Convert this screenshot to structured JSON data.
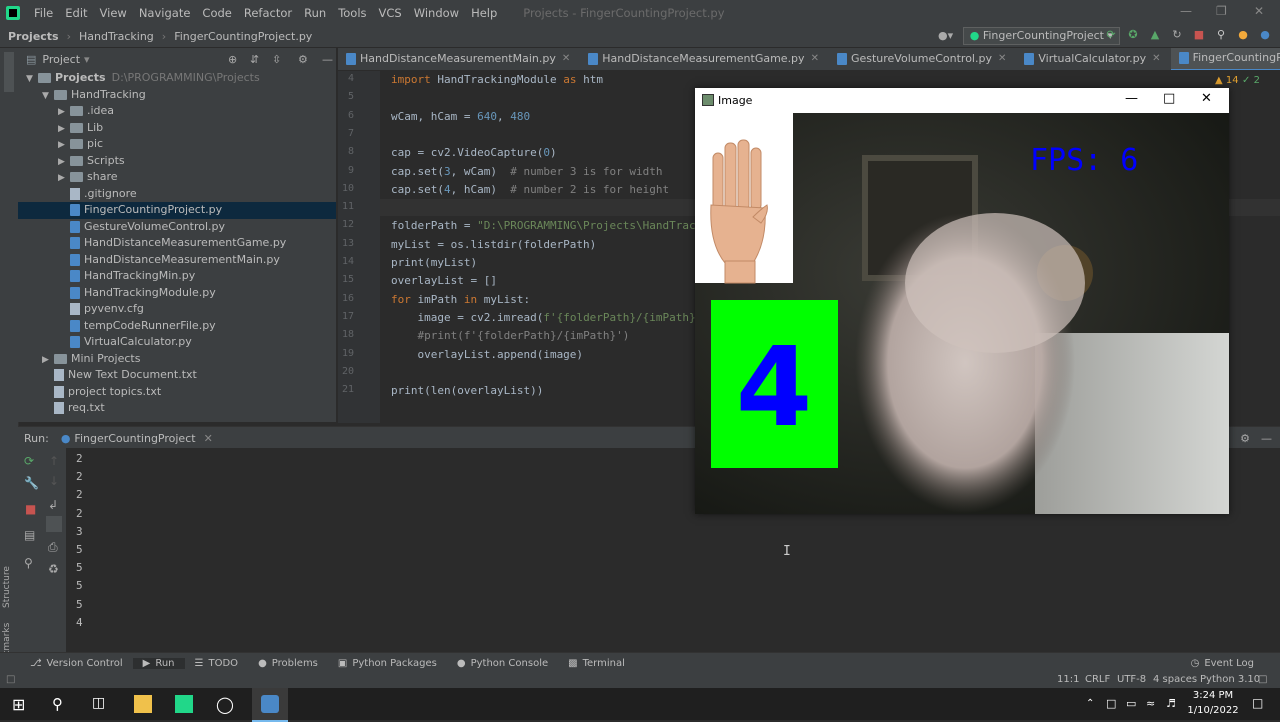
{
  "menubar": {
    "items": [
      "File",
      "Edit",
      "View",
      "Navigate",
      "Code",
      "Refactor",
      "Run",
      "Tools",
      "VCS",
      "Window",
      "Help"
    ],
    "window_title": "Projects - FingerCountingProject.py"
  },
  "navbar": {
    "crumbs": [
      "Projects",
      "HandTracking",
      "FingerCountingProject.py"
    ],
    "run_config": "FingerCountingProject"
  },
  "project_panel": {
    "title": "Project",
    "root_label": "Projects",
    "root_path": "D:\\PROGRAMMING\\Projects",
    "tree": [
      {
        "label": "HandTracking",
        "kind": "folder",
        "depth": 1,
        "expanded": true
      },
      {
        "label": ".idea",
        "kind": "folder",
        "depth": 2
      },
      {
        "label": "Lib",
        "kind": "folder",
        "depth": 2
      },
      {
        "label": "pic",
        "kind": "folder",
        "depth": 2
      },
      {
        "label": "Scripts",
        "kind": "folder",
        "depth": 2
      },
      {
        "label": "share",
        "kind": "folder",
        "depth": 2
      },
      {
        "label": ".gitignore",
        "kind": "txt",
        "depth": 2
      },
      {
        "label": "FingerCountingProject.py",
        "kind": "py",
        "depth": 2,
        "selected": true
      },
      {
        "label": "GestureVolumeControl.py",
        "kind": "py",
        "depth": 2
      },
      {
        "label": "HandDistanceMeasurementGame.py",
        "kind": "py",
        "depth": 2
      },
      {
        "label": "HandDistanceMeasurementMain.py",
        "kind": "py",
        "depth": 2
      },
      {
        "label": "HandTrackingMin.py",
        "kind": "py",
        "depth": 2
      },
      {
        "label": "HandTrackingModule.py",
        "kind": "py",
        "depth": 2
      },
      {
        "label": "pyvenv.cfg",
        "kind": "txt",
        "depth": 2
      },
      {
        "label": "tempCodeRunnerFile.py",
        "kind": "py",
        "depth": 2
      },
      {
        "label": "VirtualCalculator.py",
        "kind": "py",
        "depth": 2
      },
      {
        "label": "Mini Projects",
        "kind": "folder",
        "depth": 1
      },
      {
        "label": "New Text Document.txt",
        "kind": "txt",
        "depth": 1
      },
      {
        "label": "project topics.txt",
        "kind": "txt",
        "depth": 1
      },
      {
        "label": "req.txt",
        "kind": "txt",
        "depth": 1
      }
    ]
  },
  "tabs": [
    {
      "label": "HandDistanceMeasurementMain.py",
      "active": false
    },
    {
      "label": "HandDistanceMeasurementGame.py",
      "active": false
    },
    {
      "label": "GestureVolumeControl.py",
      "active": false
    },
    {
      "label": "VirtualCalculator.py",
      "active": false
    },
    {
      "label": "FingerCountingProject.py",
      "active": true
    }
  ],
  "inspections": {
    "warnings": "14",
    "weak": "2"
  },
  "editor": {
    "lines": [
      {
        "n": "4",
        "html": "<span class=\"kw\">import</span> HandTrackingModule <span class=\"kw\">as</span> htm"
      },
      {
        "n": "5",
        "html": ""
      },
      {
        "n": "6",
        "html": "wCam, hCam = <span class=\"num\">640</span>, <span class=\"num\">480</span>"
      },
      {
        "n": "7",
        "html": ""
      },
      {
        "n": "8",
        "html": "cap = cv2.VideoCapture(<span class=\"num\">0</span>)"
      },
      {
        "n": "9",
        "html": "cap.set(<span class=\"num\">3</span>, wCam)  <span class=\"cmt\"># number 3 is for width</span>"
      },
      {
        "n": "10",
        "html": "cap.set(<span class=\"num\">4</span>, hCam)  <span class=\"cmt\"># number 2 is for height</span>"
      },
      {
        "n": "11",
        "html": ""
      },
      {
        "n": "12",
        "html": "folderPath = <span class=\"str\">\"D:\\PROGRAMMING\\Projects\\HandTrac</span>"
      },
      {
        "n": "13",
        "html": "myList = os.listdir(folderPath)"
      },
      {
        "n": "14",
        "html": "print(myList)"
      },
      {
        "n": "15",
        "html": "overlayList = []"
      },
      {
        "n": "16",
        "html": "<span class=\"kw\">for</span> imPath <span class=\"kw\">in</span> myList:"
      },
      {
        "n": "17",
        "html": "    image = cv2.imread(<span class=\"str\">f'{folderPath}/{imPath}</span>"
      },
      {
        "n": "18",
        "html": "    <span class=\"cmt\">#print(f'{folderPath}/{imPath}')</span>"
      },
      {
        "n": "19",
        "html": "    overlayList.append(image)"
      },
      {
        "n": "20",
        "html": ""
      },
      {
        "n": "21",
        "html": "print(len(overlayList))"
      }
    ]
  },
  "run_panel": {
    "label": "Run:",
    "config": "FingerCountingProject",
    "output": [
      "2",
      "2",
      "2",
      "2",
      "3",
      "5",
      "5",
      "5",
      "5",
      "4"
    ]
  },
  "bottom_tools": [
    "Version Control",
    "Run",
    "TODO",
    "Problems",
    "Python Packages",
    "Python Console",
    "Terminal"
  ],
  "event_log": "Event Log",
  "status": {
    "position": "11:1",
    "line_sep": "CRLF",
    "encoding": "UTF-8",
    "indent": "4 spaces",
    "interpreter": "Python 3.10"
  },
  "image_window": {
    "title": "Image",
    "fps_text": "FPS: 6",
    "count": "4"
  },
  "taskbar": {
    "time": "3:24 PM",
    "date": "1/10/2022"
  }
}
